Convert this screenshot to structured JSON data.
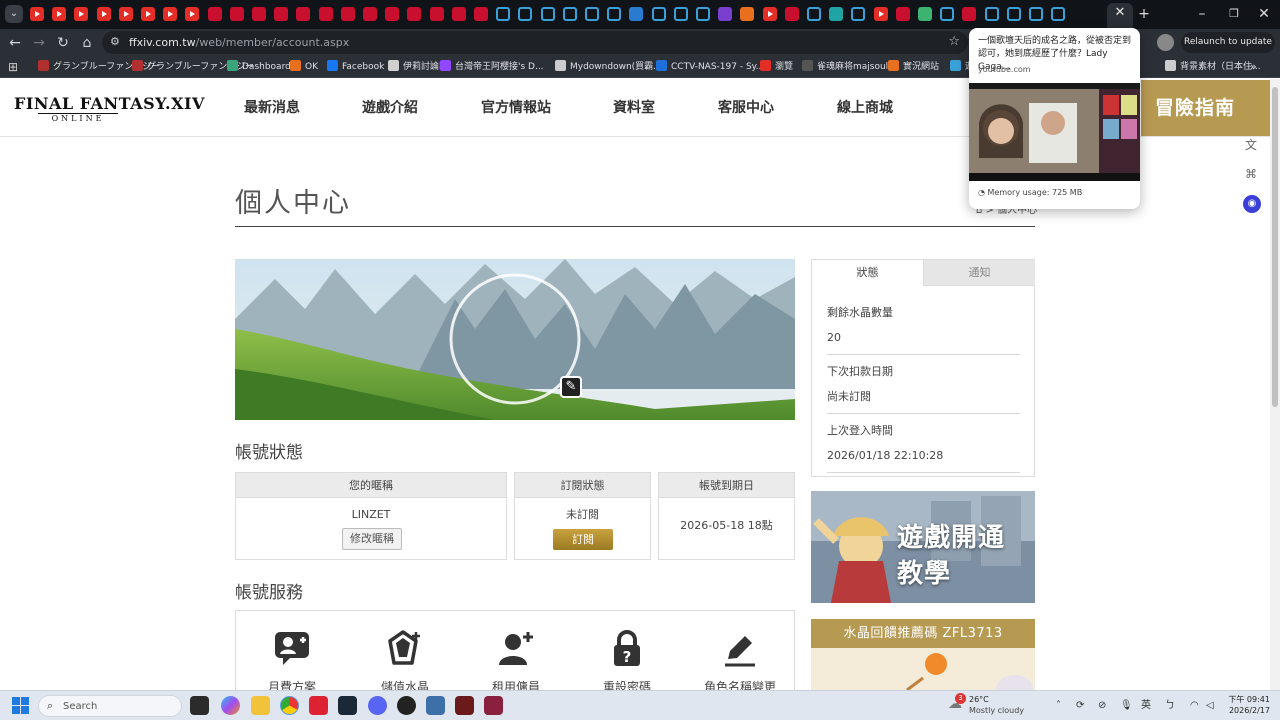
{
  "browser": {
    "url_host": "ffxiv.com.tw",
    "url_path": "/web/member/account.aspx",
    "relaunch_label": "Relaunch to update",
    "bookmarks": [
      {
        "label": "グランブルーファンタジー",
        "color": "#b03030"
      },
      {
        "label": "グランブルーファンタジー",
        "color": "#b03030"
      },
      {
        "label": "Dashboard",
        "color": "#3aa57a"
      },
      {
        "label": "OK",
        "color": "#e86f1e"
      },
      {
        "label": "Facebook",
        "color": "#1877f2"
      },
      {
        "label": "伊莉討論區",
        "color": "#d0d0d0"
      },
      {
        "label": "台灣帝王阿櫻接's D...",
        "color": "#9146ff"
      },
      {
        "label": "Mydowndown(買霸...",
        "color": "#cccccc"
      },
      {
        "label": "CCTV-NAS-197 - Sy...",
        "color": "#1e6fd9"
      },
      {
        "label": "瀏覽",
        "color": "#e52d27"
      },
      {
        "label": "雀魂麻将majsoul",
        "color": "#555555"
      },
      {
        "label": "實況網站",
        "color": "#e86f1e"
      },
      {
        "label": "遊",
        "color": "#3aa0d8"
      },
      {
        "label": "背景素材（日本住...",
        "color": "#cccccc"
      }
    ],
    "tab_popup": {
      "title": "一個歌壇天后的成名之路，從被否定到認可，她到底經歷了什麼？Lady Gaga...",
      "domain": "youtube.com",
      "memory": "Memory usage: 725 MB"
    }
  },
  "site": {
    "logo_line1": "FINAL FANTASY.XIV",
    "logo_line2": "ONLINE",
    "nav": [
      "最新消息",
      "遊戲介紹",
      "官方情報站",
      "資料室",
      "客服中心",
      "線上商城"
    ],
    "adventure_guide": "冒險指南"
  },
  "page": {
    "title": "個人中心",
    "breadcrumb": "> 個人中心",
    "account_status_heading": "帳號狀態",
    "status_boxes": {
      "nickname": {
        "header": "您的暱稱",
        "value": "LINZET",
        "button": "修改暱稱"
      },
      "subscription": {
        "header": "訂閱狀態",
        "value": "未訂閱",
        "button": "訂閱"
      },
      "expiry": {
        "header": "帳號到期日",
        "value": "2026-05-18 18點"
      }
    },
    "services_heading": "帳號服務",
    "services": [
      "月費方案",
      "儲值水晶",
      "租用傭員",
      "重設密碼",
      "角色名稱變更"
    ]
  },
  "sidebar": {
    "tabs": [
      "狀態",
      "通知"
    ],
    "rows": [
      {
        "key": "剩餘水晶數量",
        "value": "20"
      },
      {
        "key": "下次扣款日期",
        "value": "尚未訂閱"
      },
      {
        "key": "上次登入時間",
        "value": "2026/01/18 22:10:28"
      }
    ],
    "banner1_line1": "遊戲開通",
    "banner1_line2": "教學",
    "banner2": "水晶回饋推薦碼  ZFL3713"
  },
  "taskbar": {
    "search_placeholder": "Search",
    "weather_temp": "26°C",
    "weather_desc": "Mostly cloudy",
    "notif_count": "3",
    "ime": "英",
    "time": "下午 09:41",
    "date": "2026/2/17"
  },
  "colors": {
    "accent_gold": "#b69a52",
    "chrome_dark": "#101318"
  }
}
